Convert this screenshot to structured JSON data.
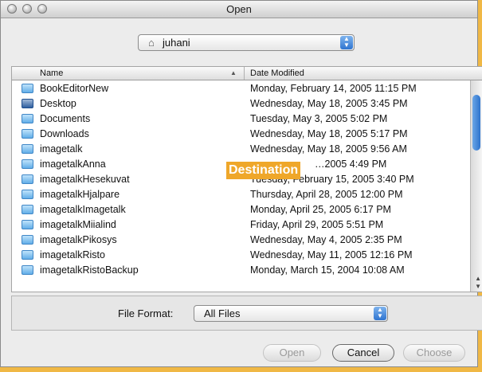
{
  "window": {
    "title": "Open"
  },
  "location": {
    "label": "juhani"
  },
  "columns": {
    "name": "Name",
    "date": "Date Modified"
  },
  "files": [
    {
      "name": "BookEditorNew",
      "date": "Monday, February 14, 2005 11:15 PM",
      "icon": "folder"
    },
    {
      "name": "Desktop",
      "date": "Wednesday, May 18, 2005 3:45 PM",
      "icon": "desktop-folder"
    },
    {
      "name": "Documents",
      "date": "Tuesday, May 3, 2005 5:02 PM",
      "icon": "documents-folder"
    },
    {
      "name": "Downloads",
      "date": "Wednesday, May 18, 2005 5:17 PM",
      "icon": "folder"
    },
    {
      "name": "imagetalk",
      "date": "Wednesday, May 18, 2005 9:56 AM",
      "icon": "folder"
    },
    {
      "name": "imagetalkAnna",
      "date": "…2005 4:49 PM",
      "icon": "folder"
    },
    {
      "name": "imagetalkHesekuvat",
      "date": "Tuesday, February 15, 2005 3:40 PM",
      "icon": "folder"
    },
    {
      "name": "imagetalkHjalpare",
      "date": "Thursday, April 28, 2005 12:00 PM",
      "icon": "folder"
    },
    {
      "name": "imagetalkImagetalk",
      "date": "Monday, April 25, 2005 6:17 PM",
      "icon": "folder"
    },
    {
      "name": "imagetalkMiialind",
      "date": "Friday, April 29, 2005 5:51 PM",
      "icon": "folder"
    },
    {
      "name": "imagetalkPikosys",
      "date": "Wednesday, May 4, 2005 2:35 PM",
      "icon": "folder"
    },
    {
      "name": "imagetalkRisto",
      "date": "Wednesday, May 11, 2005 12:16 PM",
      "icon": "folder"
    },
    {
      "name": "imagetalkRistoBackup",
      "date": "Monday, March 15, 2004 10:08 AM",
      "icon": "folder"
    }
  ],
  "overlay": {
    "label": "Destination"
  },
  "file_format": {
    "label": "File Format:",
    "value": "All Files"
  },
  "buttons": {
    "open": "Open",
    "cancel": "Cancel",
    "choose": "Choose"
  },
  "colors": {
    "accent": "#f0b845",
    "badge": "#efa72a",
    "selection_blue": "#2f74d0"
  }
}
